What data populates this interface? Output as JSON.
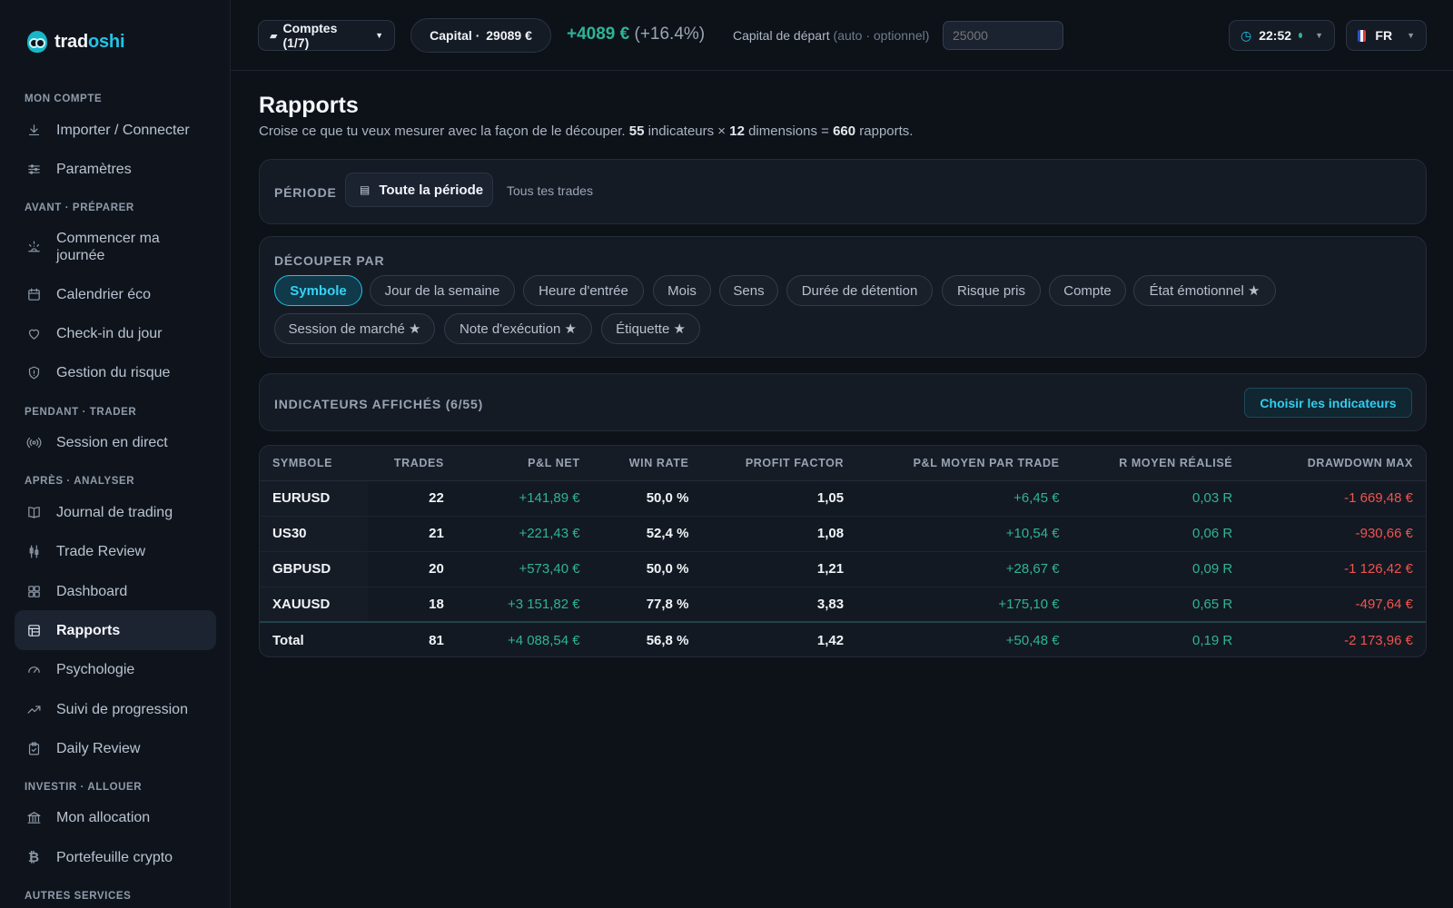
{
  "brand": {
    "prefix": "trad",
    "accent": "oshi"
  },
  "sidebar": {
    "sections": {
      "mon_compte": "MON COMPTE",
      "avant": "AVANT · PRÉPARER",
      "pendant": "PENDANT · TRADER",
      "apres": "APRÈS · ANALYSER",
      "investir": "INVESTIR · ALLOUER",
      "autres": "AUTRES SERVICES"
    },
    "items": {
      "importer": "Importer / Connecter",
      "parametres": "Paramètres",
      "commencer": "Commencer ma journée",
      "calendrier": "Calendrier éco",
      "checkin": "Check-in du jour",
      "risque": "Gestion du risque",
      "session": "Session en direct",
      "journal": "Journal de trading",
      "review": "Trade Review",
      "dashboard": "Dashboard",
      "rapports": "Rapports",
      "psychologie": "Psychologie",
      "suivi": "Suivi de progression",
      "daily": "Daily Review",
      "allocation": "Mon allocation",
      "crypto": "Portefeuille crypto"
    },
    "active": "rapports"
  },
  "topbar": {
    "accounts_label": "Comptes (1/7)",
    "capital_label": "Capital · ",
    "capital_value": "29089 €",
    "pnl_value": "+4089 €",
    "pnl_pct": "(+16.4%)",
    "start_label": "Capital de départ",
    "start_hint": "(auto · optionnel)",
    "start_placeholder": "25000",
    "clock": "22:52",
    "lang": "FR"
  },
  "page": {
    "title": "Rapports",
    "sub_1": "Croise ce que tu veux mesurer avec la façon de le découper. ",
    "indicators_count": "55",
    "sub_2": " indicateurs × ",
    "dimensions_count": "12",
    "sub_3": " dimensions = ",
    "reports_count": "660",
    "sub_4": " rapports."
  },
  "period": {
    "label": "PÉRIODE",
    "value": "Toute la période",
    "hint": "Tous tes trades"
  },
  "dimensions": {
    "label": "DÉCOUPER PAR",
    "chips": [
      "Symbole",
      "Jour de la semaine",
      "Heure d'entrée",
      "Mois",
      "Sens",
      "Durée de détention",
      "Risque pris",
      "Compte",
      "État émotionnel ★",
      "Session de marché ★",
      "Note d'exécution ★",
      "Étiquette ★"
    ],
    "active": "Symbole"
  },
  "indicators": {
    "label": "INDICATEURS AFFICHÉS (6/55)",
    "choose_button": "Choisir les indicateurs"
  },
  "table": {
    "columns": [
      "Symbole",
      "Trades",
      "P&L net",
      "Win rate",
      "Profit factor",
      "P&L moyen par trade",
      "R moyen réalisé",
      "Drawdown max"
    ],
    "rows": [
      [
        "EURUSD",
        "22",
        "+141,89 €",
        "50,0 %",
        "1,05",
        "+6,45 €",
        "0,03 R",
        "-1 669,48 €"
      ],
      [
        "US30",
        "21",
        "+221,43 €",
        "52,4 %",
        "1,08",
        "+10,54 €",
        "0,06 R",
        "-930,66 €"
      ],
      [
        "GBPUSD",
        "20",
        "+573,40 €",
        "50,0 %",
        "1,21",
        "+28,67 €",
        "0,09 R",
        "-1 126,42 €"
      ],
      [
        "XAUUSD",
        "18",
        "+3 151,82 €",
        "77,8 %",
        "3,83",
        "+175,10 €",
        "0,65 R",
        "-497,64 €"
      ]
    ],
    "total": [
      "Total",
      "81",
      "+4 088,54 €",
      "56,8 %",
      "1,42",
      "+50,48 €",
      "0,19 R",
      "-2 173,96 €"
    ]
  },
  "colors": {
    "accent": "#1ec2e6",
    "positive": "#2fb397",
    "negative": "#ef5350",
    "background": "#0d1118"
  },
  "icons": {
    "importer": "download-icon",
    "parametres": "sliders-icon",
    "commencer": "sunrise-icon",
    "calendrier": "calendar-icon",
    "checkin": "heart-icon",
    "risque": "shield-icon",
    "session": "broadcast-icon",
    "journal": "book-icon",
    "review": "candles-icon",
    "dashboard": "grid-icon",
    "rapports": "table-icon",
    "psychologie": "gauge-icon",
    "suivi": "trending-up-icon",
    "daily": "clipboard-check-icon",
    "allocation": "bank-icon",
    "crypto": "bitcoin-icon"
  }
}
